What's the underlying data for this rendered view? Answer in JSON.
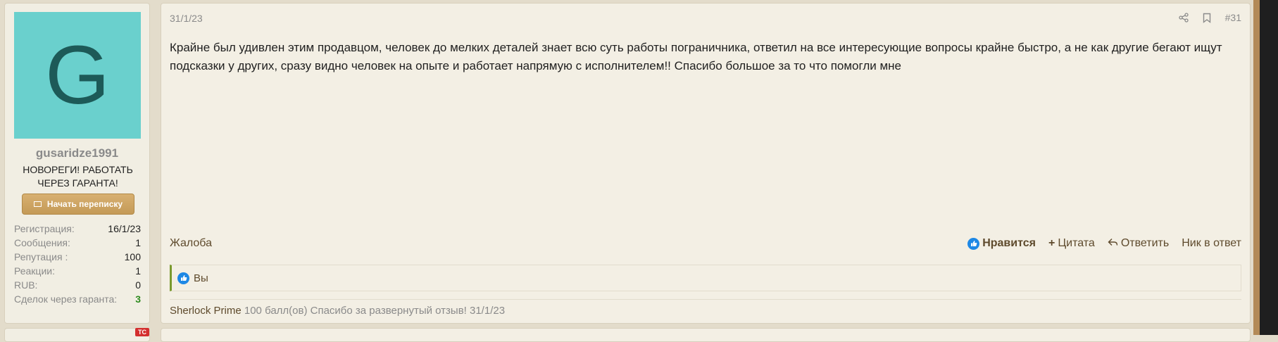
{
  "user": {
    "avatar_letter": "G",
    "username": "gusaridze1991",
    "title": "НОВОРЕГИ! РАБОТАТЬ ЧЕРЕЗ ГАРАНТА!",
    "pm_button": "Начать переписку",
    "stats": [
      {
        "key": "Регистрация:",
        "value": "16/1/23"
      },
      {
        "key": "Сообщения:",
        "value": "1"
      },
      {
        "key": "Репутация :",
        "value": "100"
      },
      {
        "key": "Реакции:",
        "value": "1"
      },
      {
        "key": "RUB:",
        "value": "0"
      },
      {
        "key": "Сделок через гаранта:",
        "value": "3"
      }
    ]
  },
  "post": {
    "date": "31/1/23",
    "number": "#31",
    "body": "Крайне был удивлен этим продавцом, человек до мелких деталей знает всю суть работы пограничника, ответил на все интересующие вопросы крайне быстро, а не как другие бегают ищут подсказки у других, сразу видно человек на опыте и работает напрямую с исполнителем!! Спасибо большое за то что помогли мне",
    "report": "Жалоба",
    "actions": {
      "like": "Нравится",
      "quote": "Цитата",
      "reply": "Ответить",
      "nick": "Ник в ответ"
    },
    "reactions": {
      "who": "Вы"
    },
    "points": {
      "who": "Sherlock Prime",
      "text": "100 балл(ов) Спасибо за развернутый отзыв! 31/1/23"
    }
  },
  "next": {
    "badge": "ТС"
  },
  "colors": {
    "avatar_bg": "#6ad0cd",
    "like_blue": "#1e88e5",
    "green": "#2e8b1f",
    "badge_red": "#d32f2f"
  }
}
